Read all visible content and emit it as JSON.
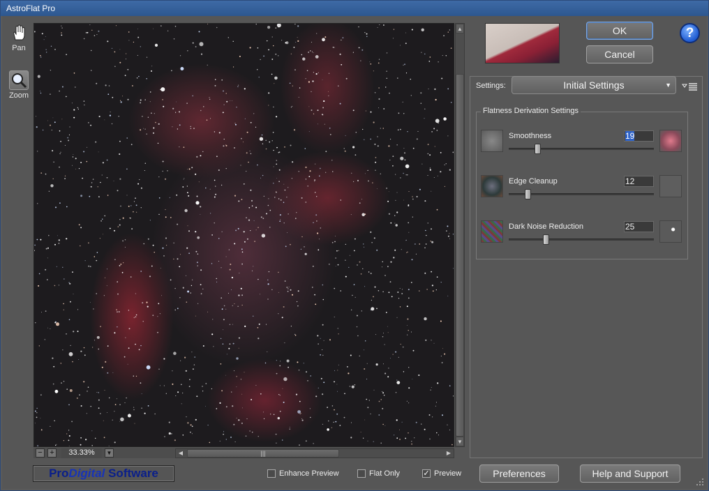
{
  "window": {
    "title": "AstroFlat Pro"
  },
  "tools": [
    {
      "label": "Pan",
      "icon": "hand-icon"
    },
    {
      "label": "Zoom",
      "icon": "magnifier-icon"
    }
  ],
  "preview": {
    "zoom_value": "33.33%"
  },
  "buttons": {
    "ok": "OK",
    "cancel": "Cancel",
    "help_icon_glyph": "?",
    "preferences": "Preferences",
    "help_support": "Help and Support"
  },
  "settings": {
    "label": "Settings:",
    "selected": "Initial Settings"
  },
  "group": {
    "title": "Flatness Derivation Settings",
    "sliders": [
      {
        "label": "Smoothness",
        "value": "19",
        "focused": true,
        "position_fraction": 0.19
      },
      {
        "label": "Edge Cleanup",
        "value": "12",
        "focused": false,
        "position_fraction": 0.12
      },
      {
        "label": "Dark Noise Reduction",
        "value": "25",
        "focused": false,
        "position_fraction": 0.25
      }
    ]
  },
  "logo": {
    "pro": "Pro",
    "digital": "Digital",
    "software": " Software"
  },
  "checkboxes": [
    {
      "label": "Enhance Preview",
      "checked": false
    },
    {
      "label": "Flat Only",
      "checked": false
    },
    {
      "label": "Preview",
      "checked": true
    }
  ],
  "colors": {
    "accent": "#2f63c8",
    "nebula": "#a02a3c",
    "logo": "#1733b7"
  }
}
